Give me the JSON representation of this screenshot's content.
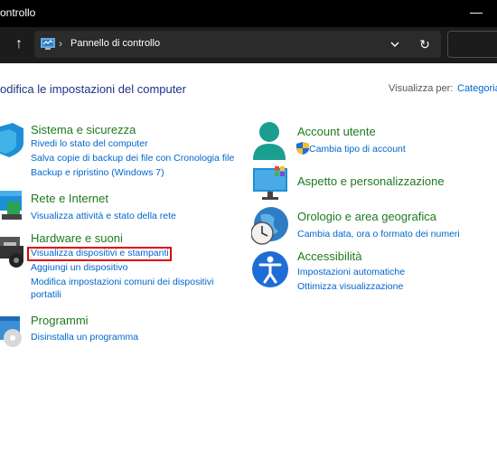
{
  "window": {
    "title": "ontrollo",
    "minimize_glyph": "—"
  },
  "nav": {
    "up_glyph": "↑",
    "chevron": "›",
    "address": "Pannello di controllo",
    "refresh_glyph": "↻"
  },
  "header": {
    "title": "odifica le impostazioni del computer",
    "view_label": "Visualizza per:",
    "view_value": "Categoria"
  },
  "categories_left": [
    {
      "title": "Sistema e sicurezza",
      "links": [
        "Rivedi lo stato del computer",
        "Salva copie di backup dei file con Cronologia file",
        "Backup e ripristino (Windows 7)"
      ]
    },
    {
      "title": "Rete e Internet",
      "links": [
        "Visualizza attività e stato della rete"
      ]
    },
    {
      "title": "Hardware e suoni",
      "links": [
        "Visualizza dispositivi e stampanti",
        "Aggiungi un dispositivo",
        "Modifica impostazioni comuni dei dispositivi",
        "portatili"
      ]
    },
    {
      "title": "Programmi",
      "links": [
        "Disinstalla un programma"
      ]
    }
  ],
  "categories_right": [
    {
      "title": "Account utente",
      "links": [
        "Cambia tipo di account"
      ]
    },
    {
      "title": "Aspetto e personalizzazione",
      "links": []
    },
    {
      "title": "Orologio e area geografica",
      "links": [
        "Cambia data, ora o formato dei numeri"
      ]
    },
    {
      "title": "Accessibilità",
      "links": [
        "Impostazioni automatiche",
        "Ottimizza visualizzazione"
      ]
    }
  ],
  "colors": {
    "titlebar": "#000000",
    "navbar": "#1c1c1c",
    "link": "#0066cc",
    "category_title": "#1e7a1e",
    "page_title": "#1e3287",
    "highlight": "#e00000"
  },
  "icons": [
    "control-panel-icon",
    "system-security-icon",
    "network-icon",
    "hardware-sound-icon",
    "programs-icon",
    "user-accounts-icon",
    "shield-icon",
    "appearance-icon",
    "clock-region-icon",
    "accessibility-icon"
  ]
}
